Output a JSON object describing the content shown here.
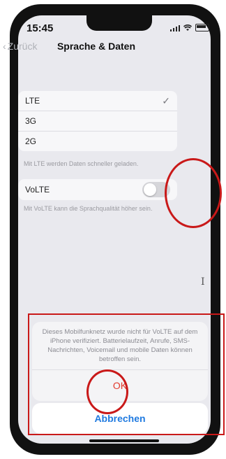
{
  "status": {
    "time": "15:45",
    "icons": [
      "signal-icon",
      "wifi-icon",
      "battery-icon"
    ]
  },
  "nav": {
    "back_label": "Zurück",
    "title": "Sprache & Daten"
  },
  "network_options": [
    {
      "label": "LTE",
      "selected": true
    },
    {
      "label": "3G",
      "selected": false
    },
    {
      "label": "2G",
      "selected": false
    }
  ],
  "network_footnote": "Mit LTE werden Daten schneller geladen.",
  "volte": {
    "label": "VoLTE",
    "enabled": false,
    "footnote": "Mit VoLTE kann die Sprachqualität höher sein."
  },
  "sheet": {
    "message": "Dieses Mobilfunknetz wurde nicht für VoLTE auf dem iPhone verifiziert. Batterielaufzeit, Anrufe, SMS-Nachrichten, Voicemail und mobile Daten können betroffen sein.",
    "ok_label": "OK",
    "cancel_label": "Abbrechen"
  },
  "colors": {
    "annotation_red": "#c91919",
    "ok_red": "#e23b2e",
    "cancel_blue": "#1f7ae0"
  }
}
